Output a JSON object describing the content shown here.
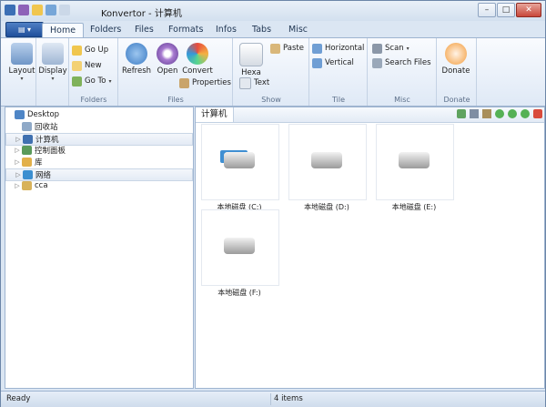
{
  "window": {
    "title": "Konvertor - 计算机"
  },
  "tabs": [
    "Home",
    "Folders",
    "Files",
    "Formats",
    "Infos",
    "Tabs",
    "Misc"
  ],
  "ribbon": {
    "layout_label": "Layout",
    "display_label": "Display",
    "go_up": "Go Up",
    "new": "New",
    "go_to": "Go To",
    "folders_group": "Folders",
    "refresh": "Refresh",
    "open": "Open",
    "convert": "Convert",
    "properties": "Properties",
    "files_group": "Files",
    "hexa": "Hexa",
    "paste": "Paste",
    "text": "Text",
    "show_group": "Show",
    "horizontal": "Horizontal",
    "vertical": "Vertical",
    "tile_group": "Tile",
    "scan": "Scan",
    "search_files": "Search Files",
    "misc_group": "Misc",
    "donate": "Donate",
    "donate_group": "Donate"
  },
  "tree": {
    "items": [
      {
        "label": "Desktop",
        "level": 0,
        "selected": false
      },
      {
        "label": "回收站",
        "level": 1,
        "selected": false
      },
      {
        "label": "计算机",
        "level": 1,
        "selected": true
      },
      {
        "label": "控制面板",
        "level": 1,
        "selected": false
      },
      {
        "label": "库",
        "level": 1,
        "selected": false
      },
      {
        "label": "网络",
        "level": 1,
        "selected": true
      },
      {
        "label": "cca",
        "level": 1,
        "selected": false
      }
    ]
  },
  "main": {
    "tab_label": "计算机",
    "drives": [
      "本地磁盘 (C:)",
      "本地磁盘 (D:)",
      "本地磁盘 (E:)",
      "本地磁盘 (F:)"
    ]
  },
  "status": {
    "left": "Ready",
    "count": "4 items"
  },
  "colors": {
    "accent": "#1f4f9b",
    "selection": "#e3ebf5",
    "ribbon_bg": "#dfe9f6"
  }
}
